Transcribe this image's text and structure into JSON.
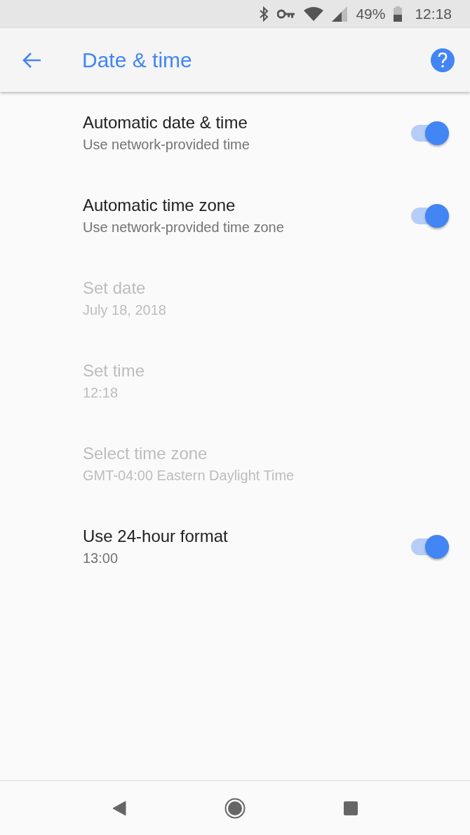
{
  "status_bar": {
    "battery_percent": "49%",
    "time": "12:18"
  },
  "toolbar": {
    "title": "Date & time"
  },
  "settings": [
    {
      "kind": "switch",
      "title": "Automatic date & time",
      "summary": "Use network-provided time",
      "disabled": false,
      "on": true
    },
    {
      "kind": "switch",
      "title": "Automatic time zone",
      "summary": "Use network-provided time zone",
      "disabled": false,
      "on": true
    },
    {
      "kind": "plain",
      "title": "Set date",
      "summary": "July 18, 2018",
      "disabled": true
    },
    {
      "kind": "plain",
      "title": "Set time",
      "summary": "12:18",
      "disabled": true
    },
    {
      "kind": "plain",
      "title": "Select time zone",
      "summary": "GMT-04:00 Eastern Daylight Time",
      "disabled": true
    },
    {
      "kind": "switch",
      "title": "Use 24-hour format",
      "summary": "13:00",
      "disabled": false,
      "on": true
    }
  ]
}
